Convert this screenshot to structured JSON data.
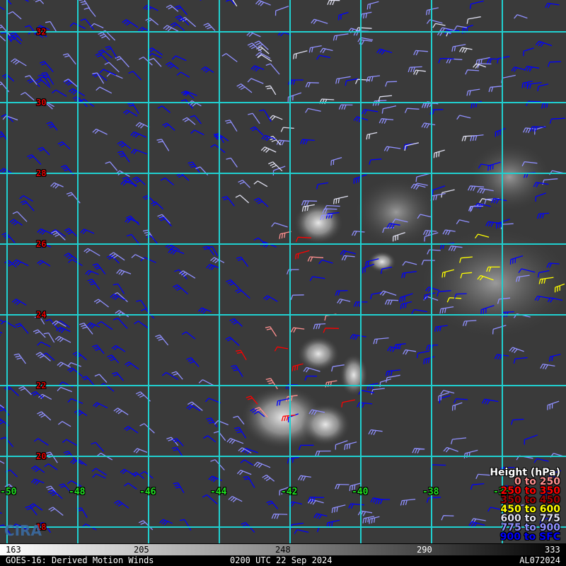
{
  "map": {
    "lat_labels": [
      "32",
      "30",
      "28",
      "26",
      "24",
      "22",
      "20",
      "18"
    ],
    "lon_labels": [
      "-50",
      "-48",
      "-46",
      "-44",
      "-42",
      "-40",
      "-38",
      "-36"
    ],
    "grid_color": "#20d0d0"
  },
  "logo": "CIRA",
  "legend": {
    "title": "Height (hPa)",
    "items": [
      {
        "label": "0 to 250",
        "color": "#ff9090"
      },
      {
        "label": "250 to 350",
        "color": "#ff0000"
      },
      {
        "label": "350 to 450",
        "color": "#a00000"
      },
      {
        "label": "450 to 600",
        "color": "#ffff00"
      },
      {
        "label": "600 to 775",
        "color": "#e0e0f0"
      },
      {
        "label": "775 to 900",
        "color": "#9090ff"
      },
      {
        "label": "900 to SFC",
        "color": "#0000ff"
      }
    ]
  },
  "colorbar": {
    "ticks": [
      "163",
      "205",
      "248",
      "290",
      "333"
    ]
  },
  "footer": {
    "left": "GOES-16: Derived Motion Winds",
    "center": "0200 UTC 22 Sep 2024",
    "right": "AL072024"
  }
}
